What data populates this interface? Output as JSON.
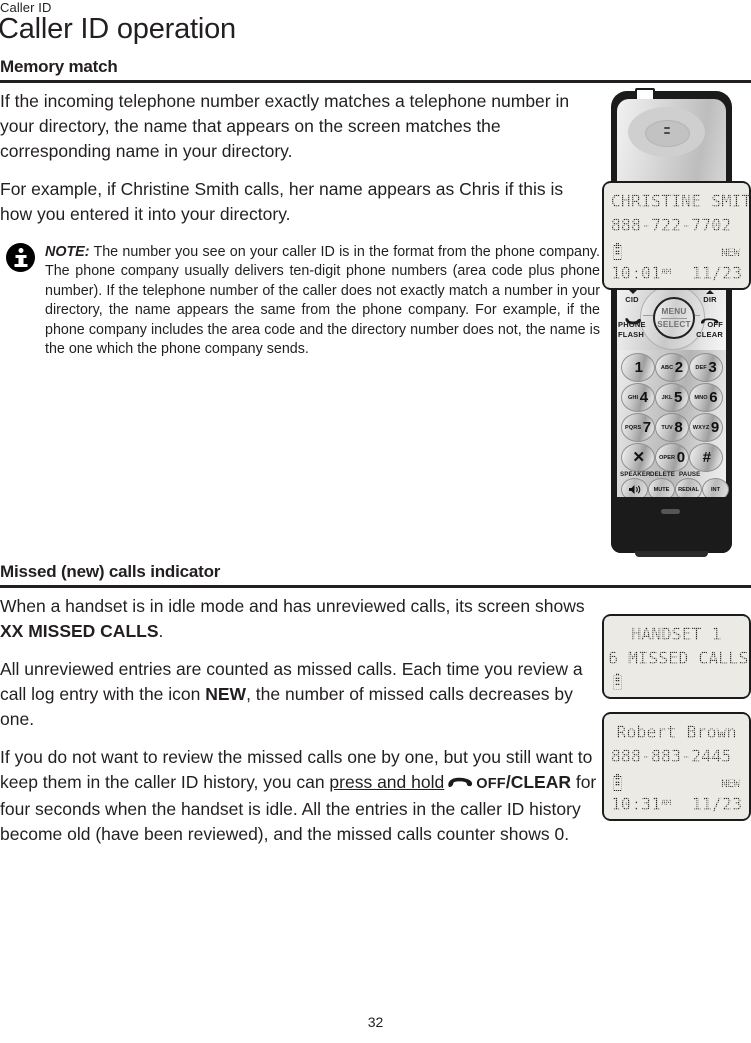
{
  "header": {
    "running_head": "Caller ID",
    "chapter_title": "Caller ID operation"
  },
  "sections": [
    {
      "heading": "Memory match",
      "paragraphs": [
        "If the incoming telephone number exactly matches a telephone number in your directory, the name that appears on the screen matches the corresponding name in your directory.",
        "For example, if Christine Smith calls, her name appears as Chris if this is how you entered it into your directory."
      ],
      "note": {
        "label": "NOTE:",
        "text": " The number you see on your caller ID is in the format from the phone company. The phone company usually delivers ten-digit phone numbers (area code plus phone number). If the telephone number of the caller does not exactly match a number in your directory, the name appears the same from the phone company. For example, if the phone company includes the area code and the directory number does not, the name is the one which the phone company sends."
      }
    },
    {
      "heading": "Missed (new) calls indicator",
      "para1_a": "When a handset is in idle mode and has unreviewed calls, its screen shows ",
      "para1_bold": "XX MISSED CALLS",
      "para1_b": ".",
      "para2_a": "All unreviewed entries are counted as missed calls. Each time you review a call log entry with the icon ",
      "para2_bold": "NEW",
      "para2_b": ", the number of missed calls decreases by one.",
      "para3_a": "If you do not want to review the missed calls one by one, but you still want to keep them in the caller ID history, you can ",
      "para3_press": "press and hold",
      "para3_off": "OFF",
      "para3_clear": "/CLEAR",
      "para3_b": " for four seconds when the handset is idle. All the entries in the caller ID history become old (have been reviewed), and the missed calls counter shows 0."
    }
  ],
  "phone": {
    "nav": {
      "cid": "CID",
      "dir": "DIR",
      "menu": "MENU",
      "select": "SELECT",
      "phone": "PHONE",
      "flash": "FLASH",
      "off": "OFF",
      "clear": "CLEAR"
    },
    "keys": [
      {
        "letters": "",
        "digit": "1"
      },
      {
        "letters": "ABC",
        "digit": "2"
      },
      {
        "letters": "DEF",
        "digit": "3"
      },
      {
        "letters": "GHI",
        "digit": "4"
      },
      {
        "letters": "JKL",
        "digit": "5"
      },
      {
        "letters": "MNO",
        "digit": "6"
      },
      {
        "letters": "PQRS",
        "digit": "7"
      },
      {
        "letters": "TUV",
        "digit": "8"
      },
      {
        "letters": "WXYZ",
        "digit": "9"
      },
      {
        "letters": "",
        "digit": "✕"
      },
      {
        "letters": "OPER",
        "digit": "0"
      },
      {
        "letters": "",
        "digit": "#"
      }
    ],
    "function_labels": {
      "speaker": "SPEAKER",
      "delete": "DELETE",
      "pause": "PAUSE"
    },
    "function_keys": {
      "speaker": "",
      "mute": "MUTE",
      "redial": "REDIAL",
      "intercom": "INT"
    }
  },
  "lcd_main": {
    "name": "CHRISTINE SMITH",
    "number": "888-722-7702",
    "new_flag": "NEW",
    "time": "10:01",
    "ampm": "AM",
    "date": "11/23"
  },
  "lcd_handset": {
    "line1": "HANDSET 1",
    "line2": "6 MISSED CALLS"
  },
  "lcd_robert": {
    "name": "Robert Brown",
    "number": "888-883-2445",
    "new_flag": "NEW",
    "time": "10:31",
    "ampm": "AM",
    "date": "11/23"
  },
  "footer": {
    "page_number": "32"
  }
}
